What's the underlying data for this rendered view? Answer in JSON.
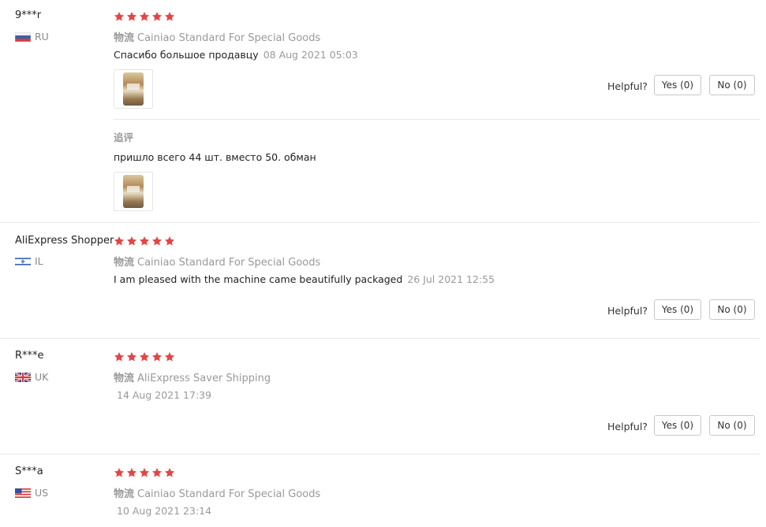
{
  "colors": {
    "star": "#e64545",
    "muted": "#999999",
    "divider": "#e8e8e8"
  },
  "helpful_label": "Helpful?",
  "reviews": [
    {
      "user": "9***r",
      "country": "RU",
      "flag": "russia-flag-icon",
      "stars": 5,
      "shipping_cn": "物流",
      "shipping": "Cainiao Standard For Special Goods",
      "text": "Спасибо большое продавцу",
      "date": "08 Aug 2021 05:03",
      "has_photo": true,
      "followup": {
        "label": "追评",
        "text": "пришло всего 44 шт. вместо 50. обман",
        "has_photo": true
      },
      "yes": "Yes (0)",
      "no": "No (0)"
    },
    {
      "user": "AliExpress Shopper",
      "country": "IL",
      "flag": "israel-flag-icon",
      "stars": 5,
      "shipping_cn": "物流",
      "shipping": "Cainiao Standard For Special Goods",
      "text": "I am pleased with the machine came beautifully packaged",
      "date": "26 Jul 2021 12:55",
      "yes": "Yes (0)",
      "no": "No (0)"
    },
    {
      "user": "R***e",
      "country": "UK",
      "flag": "uk-flag-icon",
      "stars": 5,
      "shipping_cn": "物流",
      "shipping": "AliExpress Saver Shipping",
      "date": "14 Aug 2021 17:39",
      "yes": "Yes (0)",
      "no": "No (0)"
    },
    {
      "user": "S***a",
      "country": "US",
      "flag": "us-flag-icon",
      "stars": 5,
      "shipping_cn": "物流",
      "shipping": "Cainiao Standard For Special Goods",
      "date": "10 Aug 2021 23:14"
    }
  ]
}
